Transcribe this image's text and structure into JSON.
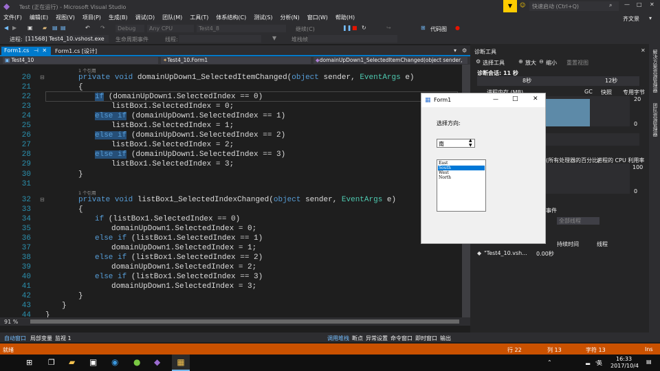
{
  "window": {
    "title": "Test (正在运行) - Microsoft Visual Studio",
    "quick_launch": "快速启动 (Ctrl+Q)",
    "user": "齐文景"
  },
  "menu": [
    "文件(F)",
    "编辑(E)",
    "视图(V)",
    "项目(P)",
    "生成(B)",
    "调试(D)",
    "团队(M)",
    "工具(T)",
    "体系结构(C)",
    "测试(S)",
    "分析(N)",
    "窗口(W)",
    "帮助(H)"
  ],
  "toolbar": {
    "config": "Debug",
    "platform": "Any CPU",
    "project": "Test4_8",
    "continue": "继续(C)",
    "code_map": "代码图"
  },
  "toolbar2": {
    "process_label": "进程:",
    "process": "[11568] Test4_10.vshost.exe",
    "lifecycle": "生命周期事件",
    "thread_label": "线程:",
    "stack_label": "堆栈帧:"
  },
  "tabs": [
    "Form1.cs",
    "Form1.cs [设计]"
  ],
  "nav": {
    "project": "Test4_10",
    "class": "Test4_10.Form1",
    "member": "domainUpDown1_SelectedItemChanged(object sender,"
  },
  "code": {
    "ref_label": "1 个引用",
    "lines": [
      {
        "n": "20",
        "t": "private void domainUpDown1_SelectedItemChanged(object sender, EventArgs e)"
      },
      {
        "n": "21",
        "t": "{"
      },
      {
        "n": "22",
        "t": "if (domainUpDown1.SelectedIndex == 0)"
      },
      {
        "n": "23",
        "t": "listBox1.SelectedIndex = 0;"
      },
      {
        "n": "24",
        "t": "else if (domainUpDown1.SelectedIndex == 1)"
      },
      {
        "n": "25",
        "t": "listBox1.SelectedIndex = 1;"
      },
      {
        "n": "26",
        "t": "else if (domainUpDown1.SelectedIndex == 2)"
      },
      {
        "n": "27",
        "t": "listBox1.SelectedIndex = 2;"
      },
      {
        "n": "28",
        "t": "else if (domainUpDown1.SelectedIndex == 3)"
      },
      {
        "n": "29",
        "t": "listBox1.SelectedIndex = 3;"
      },
      {
        "n": "30",
        "t": "}"
      },
      {
        "n": "31",
        "t": ""
      },
      {
        "n": "32",
        "t": "private void listBox1_SelectedIndexChanged(object sender, EventArgs e)"
      },
      {
        "n": "33",
        "t": "{"
      },
      {
        "n": "34",
        "t": "if (listBox1.SelectedIndex == 0)"
      },
      {
        "n": "35",
        "t": "domainUpDown1.SelectedIndex = 0;"
      },
      {
        "n": "36",
        "t": "else if (listBox1.SelectedIndex == 1)"
      },
      {
        "n": "37",
        "t": "domainUpDown1.SelectedIndex = 1;"
      },
      {
        "n": "38",
        "t": "else if (listBox1.SelectedIndex == 2)"
      },
      {
        "n": "39",
        "t": "domainUpDown1.SelectedIndex = 2;"
      },
      {
        "n": "40",
        "t": "else if (listBox1.SelectedIndex == 3)"
      },
      {
        "n": "41",
        "t": "domainUpDown1.SelectedIndex = 3;"
      },
      {
        "n": "42",
        "t": "}"
      },
      {
        "n": "43",
        "t": "}"
      },
      {
        "n": "44",
        "t": "}"
      }
    ]
  },
  "zoom": "91 %",
  "diagnostics": {
    "title": "诊断工具",
    "select_tool": "选择工具",
    "zoom_in": "放大",
    "zoom_out": "缩小",
    "reset_view": "重置视图",
    "session": "诊断会话: 11 秒",
    "t8": "8秒",
    "t12": "12秒",
    "memory_label": "进程内存 (MB)",
    "gc": "GC",
    "snapshot": "快照",
    "private_bytes": "专用字节",
    "mem_max": "20",
    "mem_min": "0",
    "cpu_label": "(所有处理器的百分比)",
    "cpu_usage": "进程的 CPU 利用率",
    "cpu_max": "100",
    "cpu_min": "0",
    "events_header": "事件",
    "all_threads": "全部线程",
    "col_duration": "持续时间",
    "col_thread": "线程",
    "row_name": "\"Test4_10.vsh...",
    "row_duration": "0.00秒"
  },
  "side_tabs": [
    "解决方案资源管理器",
    "团队资源管理器"
  ],
  "form": {
    "title": "Form1",
    "label": "选择方向:",
    "spinner_value": "南",
    "list_items": [
      "East",
      "South",
      "West",
      "North"
    ],
    "selected": 1
  },
  "bottom_tabs_left": [
    "自动窗口",
    "局部变量",
    "监视 1"
  ],
  "bottom_tabs_right": [
    "调用堆栈",
    "断点",
    "异常设置",
    "命令窗口",
    "即时窗口",
    "输出"
  ],
  "status": {
    "ready": "就绪",
    "line": "行 22",
    "col": "列 13",
    "char": "字符 13",
    "ins": "Ins"
  },
  "clock": {
    "time": "16:33",
    "date": "2017/10/4",
    "ime": "英"
  },
  "colors": {
    "accent": "#007acc",
    "status": "#ca5100",
    "selection": "#0078d7"
  }
}
